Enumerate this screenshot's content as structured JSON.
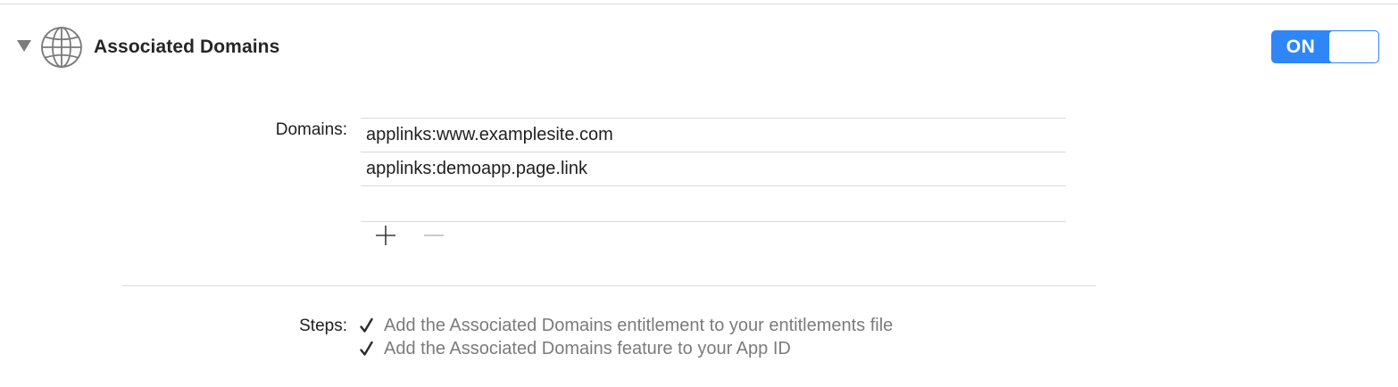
{
  "section": {
    "title": "Associated Domains",
    "icon": "globe-icon",
    "disclosure_icon": "disclosure-triangle-icon",
    "toggle": {
      "label": "ON",
      "state": "on",
      "accent_color": "#2f86f6"
    }
  },
  "domains": {
    "label": "Domains:",
    "items": [
      "applinks:www.examplesite.com",
      "applinks:demoapp.page.link"
    ],
    "add_icon": "plus-icon",
    "remove_icon": "minus-icon"
  },
  "steps": {
    "label": "Steps:",
    "items": [
      "Add the Associated Domains entitlement to your entitlements file",
      "Add the Associated Domains feature to your App ID"
    ],
    "check_icon": "checkmark-icon"
  }
}
